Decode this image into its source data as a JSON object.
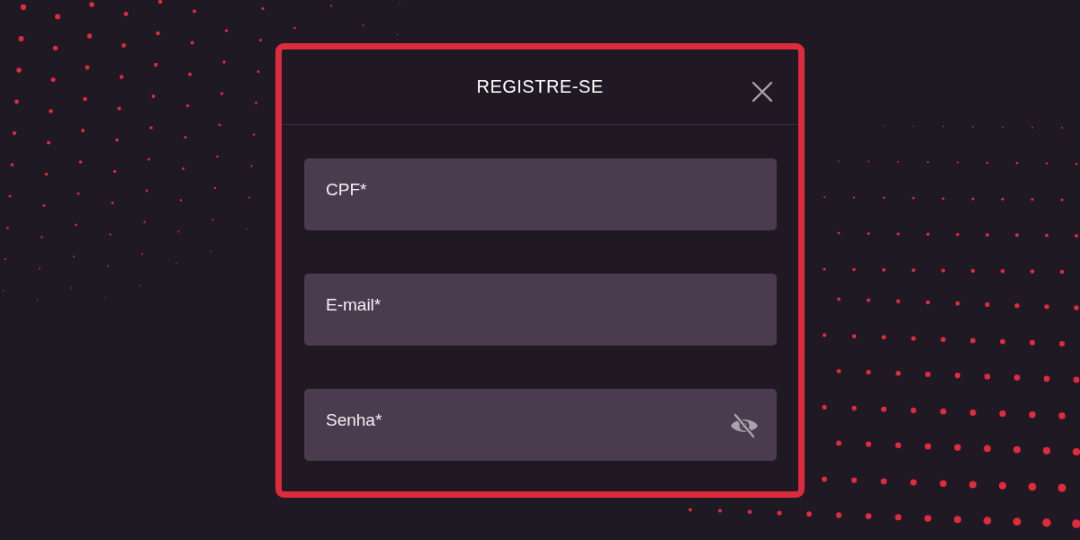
{
  "modal": {
    "title": "REGISTRE-SE"
  },
  "fields": [
    {
      "kind": "text",
      "placeholder": "CPF*"
    },
    {
      "kind": "email",
      "placeholder": "E-mail*"
    },
    {
      "kind": "password",
      "placeholder": "Senha*"
    }
  ]
}
